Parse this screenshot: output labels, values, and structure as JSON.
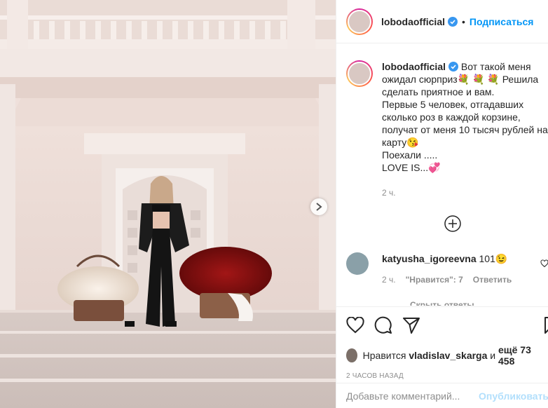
{
  "post": {
    "username": "lobodaofficial",
    "follow_label": "Подписаться",
    "dot": "•"
  },
  "caption": {
    "username": "lobodaofficial",
    "line1": " Вот такой меня ожидал сюрприз",
    "emoji1": "💐 💐 💐",
    "line2": " Решила сделать приятное и вам.",
    "line3": "Первые 5 человек, отгадавших сколько роз в каждой корзине, получат от меня 10 тысяч рублей на карту",
    "emoji2": "😘",
    "line4": "Поехали .....",
    "line5": "LOVE IS...",
    "emoji3": "💞",
    "time": "2 ч."
  },
  "comment": {
    "username": "katyusha_igoreevna",
    "text": "101",
    "emoji": "😉",
    "time": "2 ч.",
    "likes": "\"Нравится\": 7",
    "reply": "Ответить",
    "hide_replies": "Скрыть ответы"
  },
  "likes": {
    "prefix": "Нравится",
    "user": "vladislav_skarga",
    "middle": "и",
    "rest": "ещё 73 458"
  },
  "date": "2 ЧАСОВ НАЗАД",
  "comment_box": {
    "placeholder": "Добавьте комментарий...",
    "publish_label": "Опубликовать"
  },
  "icons": {
    "verified": "verified-badge-icon",
    "like": "heart-icon",
    "comment": "comment-icon",
    "share": "paper-plane-icon",
    "save": "bookmark-icon",
    "load_more": "plus-circle-icon",
    "next": "chevron-right-icon"
  },
  "colors": {
    "accent": "#0095f6",
    "verified": "#3897f0",
    "muted": "#8e8e8e",
    "publish_disabled": "#b2dffc"
  }
}
